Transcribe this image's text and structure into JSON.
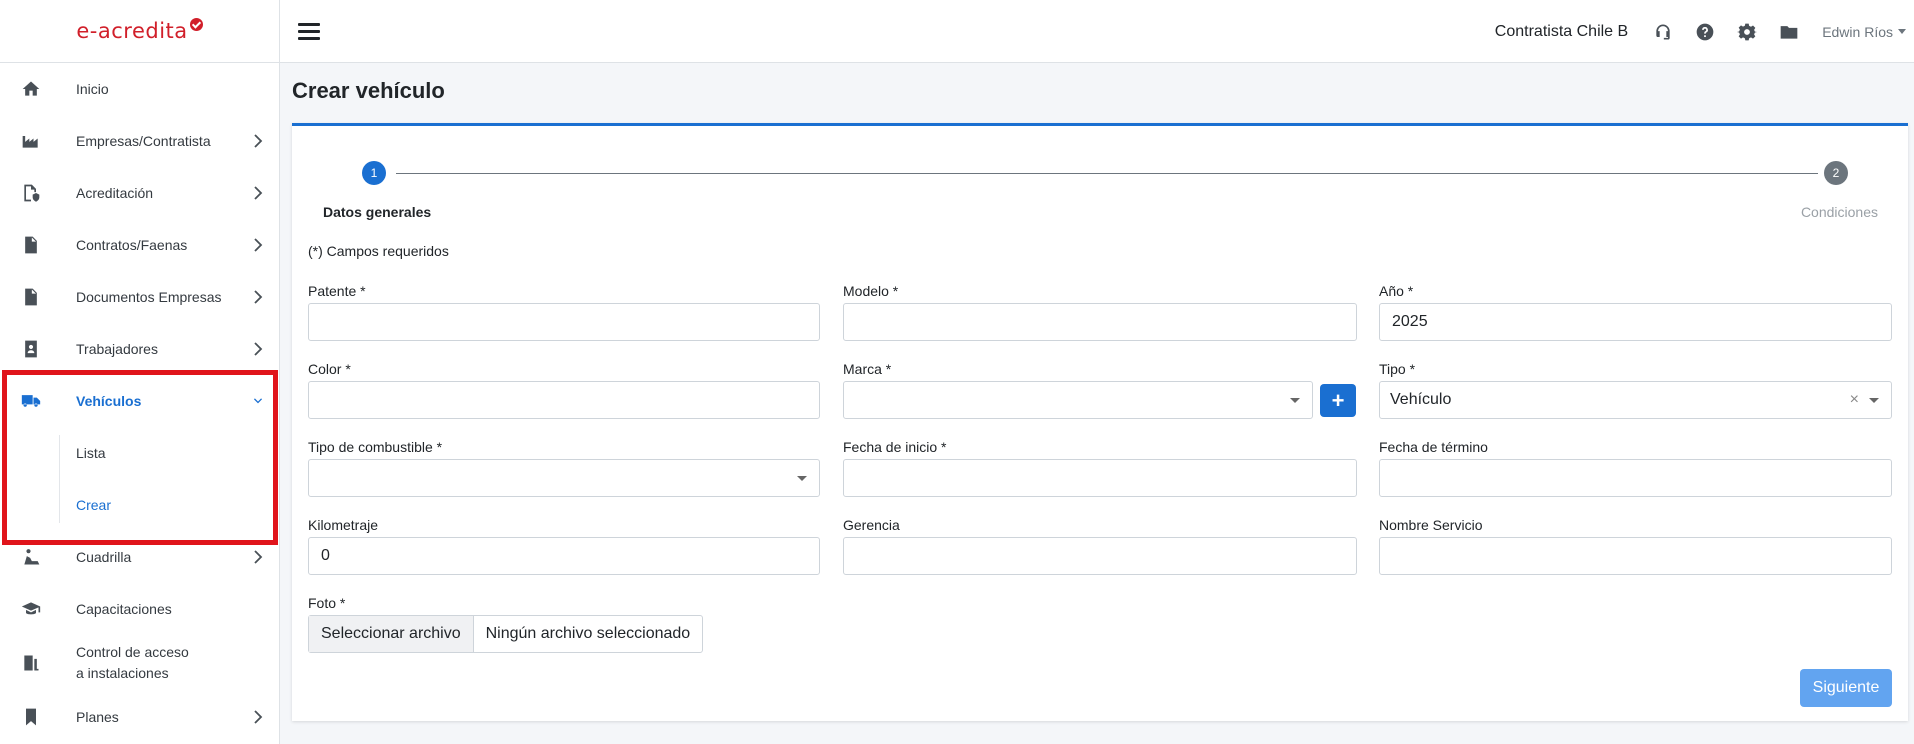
{
  "brand": {
    "name": "e-acredita"
  },
  "sidebar": {
    "items": [
      {
        "label": "Inicio",
        "icon": "home-icon"
      },
      {
        "label": "Empresas/Contratista",
        "icon": "industry-icon"
      },
      {
        "label": "Acreditación",
        "icon": "file-shield-icon"
      },
      {
        "label": "Contratos/Faenas",
        "icon": "contract-icon"
      },
      {
        "label": "Documentos Empresas",
        "icon": "document-icon"
      },
      {
        "label": "Trabajadores",
        "icon": "id-badge-icon"
      },
      {
        "label": "Vehículos",
        "icon": "truck-icon"
      },
      {
        "label": "Cuadrilla",
        "icon": "worker-icon"
      },
      {
        "label": "Capacitaciones",
        "icon": "graduation-cap-icon"
      },
      {
        "label": "Control de acceso",
        "label2": "a instalaciones",
        "icon": "door-icon"
      },
      {
        "label": "Planes",
        "icon": "bookmark-icon"
      }
    ],
    "submenu": [
      {
        "label": "Lista"
      },
      {
        "label": "Crear"
      }
    ]
  },
  "header": {
    "company": "Contratista Chile B",
    "user": "Edwin Ríos",
    "icons": [
      "headset-icon",
      "question-icon",
      "gear-icon",
      "folder-icon"
    ]
  },
  "page": {
    "title": "Crear vehículo"
  },
  "stepper": {
    "steps": [
      {
        "number": "1",
        "label": "Datos generales"
      },
      {
        "number": "2",
        "label": "Condiciones"
      }
    ]
  },
  "form": {
    "required_note": "(*) Campos requeridos",
    "patente": {
      "label": "Patente *",
      "value": ""
    },
    "modelo": {
      "label": "Modelo *",
      "value": ""
    },
    "anio": {
      "label": "Año *",
      "value": "2025"
    },
    "color": {
      "label": "Color *",
      "value": ""
    },
    "marca": {
      "label": "Marca *",
      "value": "",
      "add_label": "+"
    },
    "tipo": {
      "label": "Tipo *",
      "value": "Vehículo",
      "clear": "×"
    },
    "combustible": {
      "label": "Tipo de combustible *",
      "value": ""
    },
    "fecha_inicio": {
      "label": "Fecha de inicio *",
      "value": ""
    },
    "fecha_termino": {
      "label": "Fecha de término",
      "value": ""
    },
    "kilometraje": {
      "label": "Kilometraje",
      "value": "0"
    },
    "gerencia": {
      "label": "Gerencia",
      "value": ""
    },
    "nombre_servicio": {
      "label": "Nombre Servicio",
      "value": ""
    },
    "foto": {
      "label": "Foto *",
      "button": "Seleccionar archivo",
      "filename": "Ningún archivo seleccionado"
    }
  },
  "actions": {
    "next": "Siguiente"
  },
  "colors": {
    "accent": "#1a6fd1",
    "brand": "#d11f2a",
    "highlight": "#e0141b"
  }
}
